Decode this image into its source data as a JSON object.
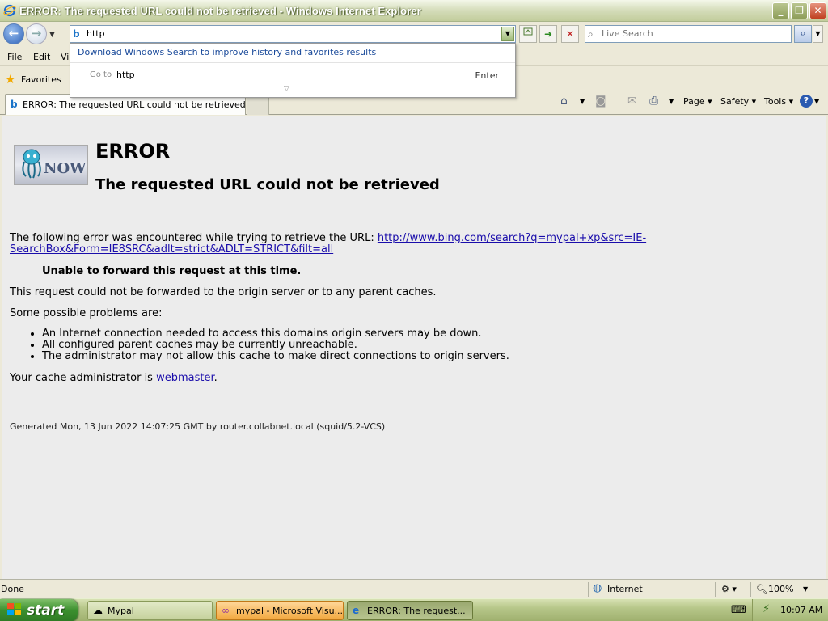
{
  "window": {
    "title": "ERROR: The requested URL could not be retrieved - Windows Internet Explorer",
    "minimize": "_",
    "restore": "❐",
    "close": "✕"
  },
  "navbar": {
    "back_glyph": "←",
    "forward_glyph": "→",
    "address_value": "http",
    "search_placeholder": "Live Search"
  },
  "autocomplete": {
    "download_text": "Download Windows Search to improve history and favorites results",
    "goto_label": "Go to",
    "goto_value": "http",
    "enter_label": "Enter"
  },
  "menubar": {
    "items": [
      "File",
      "Edit",
      "Vi"
    ]
  },
  "favorites": {
    "label": "Favorites"
  },
  "tabs": [
    {
      "label": "ERROR: The requested URL could not be retrieved"
    }
  ],
  "commandbar": {
    "page": "Page",
    "safety": "Safety",
    "tools": "Tools"
  },
  "page": {
    "logo_text": "NOW",
    "heading": "ERROR",
    "subheading": "The requested URL could not be retrieved",
    "error_intro": "The following error was encountered while trying to retrieve the URL: ",
    "error_url_line1": "http://www.bing.com/search?q=mypal+xp&src=IE-",
    "error_url_line2": "SearchBox&Form=IE8SRC&adlt=strict&ADLT=STRICT&filt=all",
    "unable": "Unable to forward this request at this time.",
    "not_forwarded": "This request could not be forwarded to the origin server or to any parent caches.",
    "possible": "Some possible problems are:",
    "problems": [
      "An Internet connection needed to access this domains origin servers may be down.",
      "All configured parent caches may be currently unreachable.",
      "The administrator may not allow this cache to make direct connections to origin servers."
    ],
    "admin_prefix": "Your cache administrator is ",
    "admin_link": "webmaster",
    "admin_suffix": ".",
    "generated": "Generated Mon, 13 Jun 2022 14:07:25 GMT by router.collabnet.local (squid/5.2-VCS)"
  },
  "statusbar": {
    "status": "Done",
    "zone": "Internet",
    "zoom": "100%"
  },
  "taskbar": {
    "start": "start",
    "tasks": [
      {
        "label": "Mypal"
      },
      {
        "label": "mypal - Microsoft Visu..."
      },
      {
        "label": "ERROR: The request..."
      }
    ],
    "clock": "10:07 AM"
  },
  "colors": {
    "link": "#1a0dab",
    "content_bg": "#ececec",
    "chrome_bg": "#ece9d8",
    "start_green": "#3b8f2e"
  }
}
